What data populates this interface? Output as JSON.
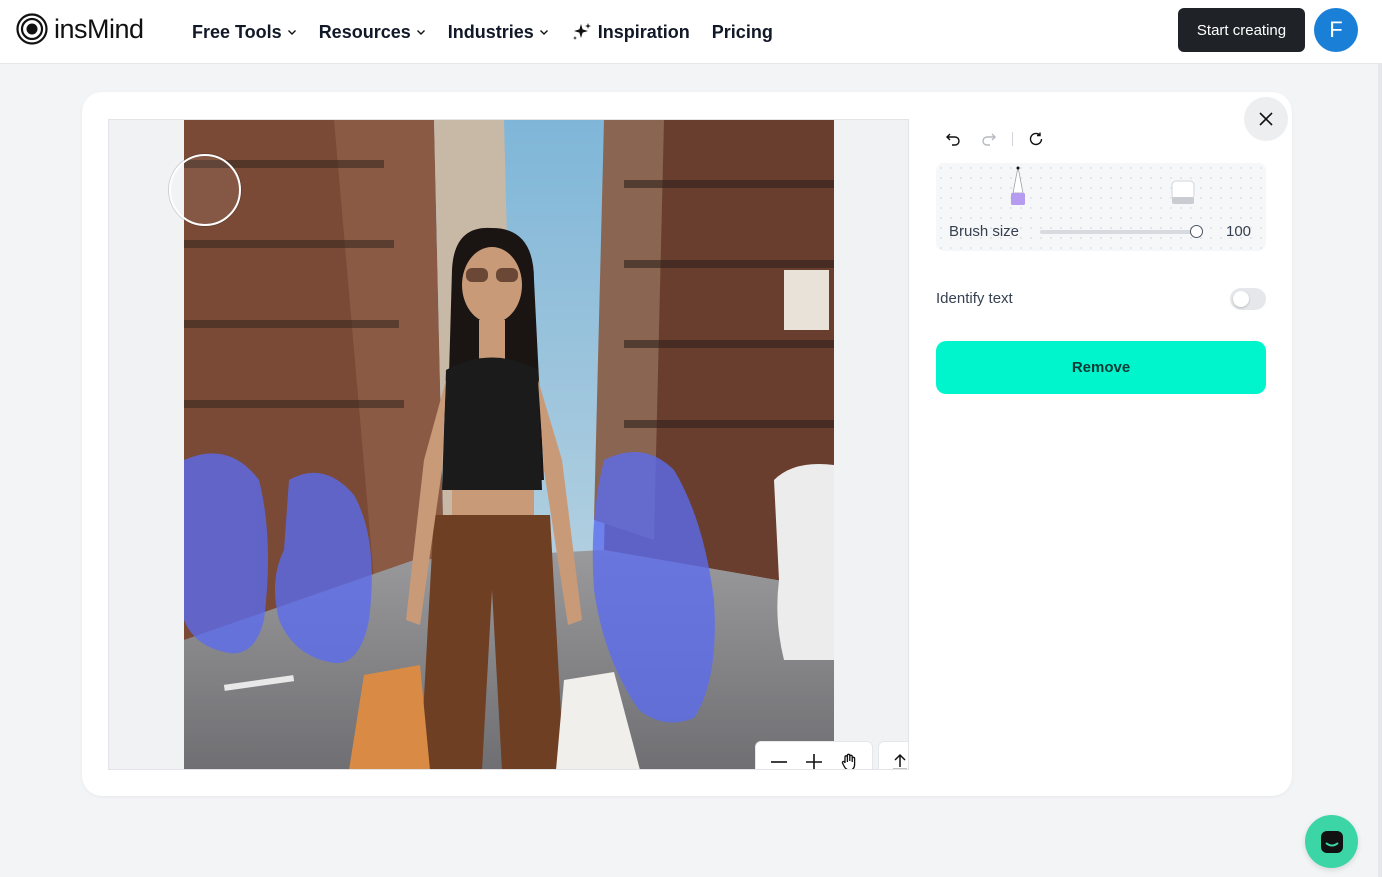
{
  "header": {
    "logo_text": "insMind",
    "nav": [
      {
        "label": "Free Tools",
        "has_dropdown": true
      },
      {
        "label": "Resources",
        "has_dropdown": true
      },
      {
        "label": "Industries",
        "has_dropdown": true
      },
      {
        "label": "Inspiration",
        "has_dropdown": false,
        "icon": "sparkle-icon"
      },
      {
        "label": "Pricing",
        "has_dropdown": false
      }
    ],
    "start_label": "Start creating",
    "avatar_initial": "F"
  },
  "editor": {
    "brush_size_label": "Brush size",
    "brush_size_value": "100",
    "brush_size_fraction": 0.98,
    "identify_text_label": "Identify text",
    "identify_text_enabled": false,
    "remove_label": "Remove"
  },
  "colors": {
    "accent": "#00f5cc",
    "mask": "#5b6cf0",
    "dark_button": "#1f2328",
    "avatar": "#1a7fd6",
    "chat": "#3cd6a6"
  }
}
